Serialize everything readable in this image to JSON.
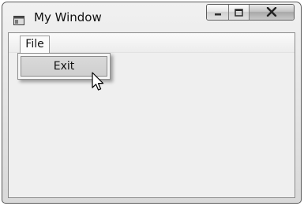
{
  "window": {
    "title": "My Window",
    "app_icon": "window-app-icon",
    "caption_buttons": [
      "minimize-icon",
      "maximize-icon",
      "close-icon"
    ]
  },
  "menubar": {
    "items": [
      {
        "label": "File"
      }
    ]
  },
  "dropdown": {
    "items": [
      {
        "label": "Exit"
      }
    ]
  },
  "cursor": "arrow-cursor-icon",
  "colors": {
    "title_text": "#111111",
    "window_frame": "#5a5a5a",
    "client_background": "#efefef",
    "highlight": "#d4d4d4"
  }
}
